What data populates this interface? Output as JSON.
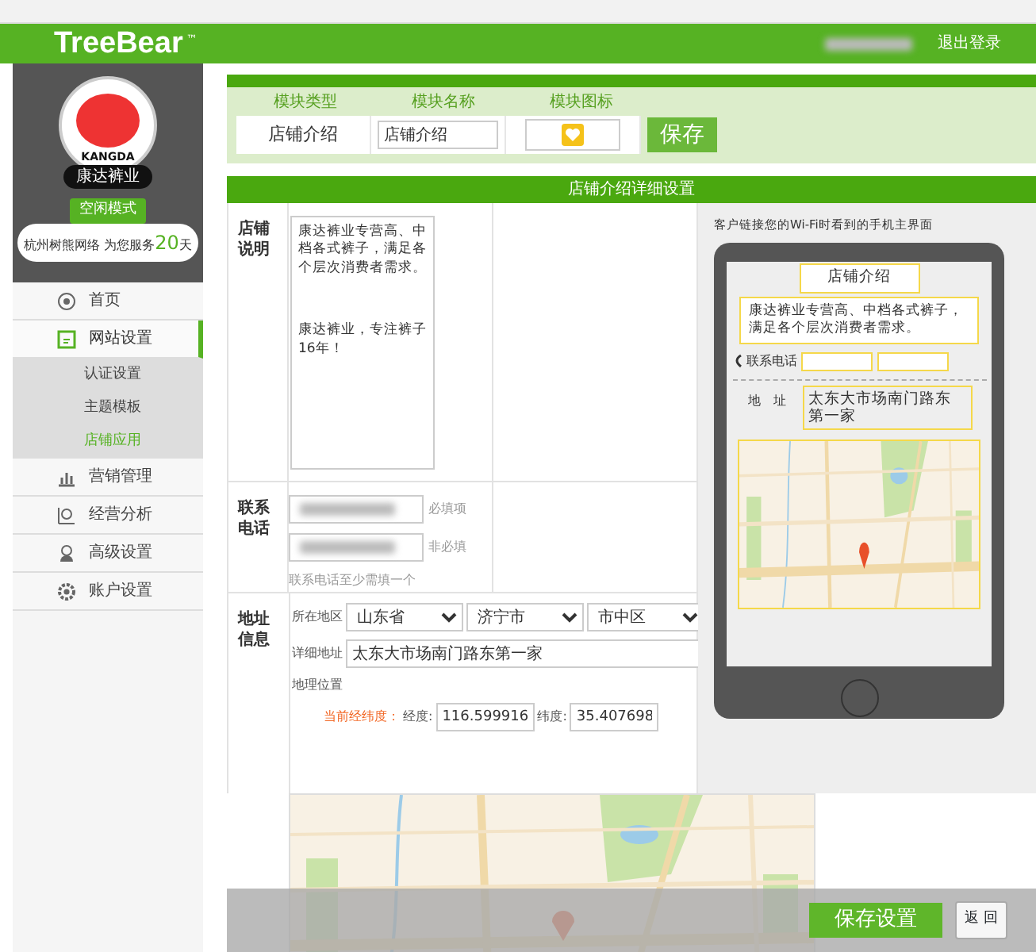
{
  "header": {
    "logo": "TreeBear",
    "trademark": "™",
    "logout": "退出登录"
  },
  "sidebar": {
    "logo_text": "KANGDA",
    "shop_name": "康达裤业",
    "mode_badge": "空闲模式",
    "service_prefix": "杭州树熊网络 为您服务",
    "service_days": "20",
    "service_suffix": "天",
    "menu": [
      {
        "label": "首页",
        "selected": false
      },
      {
        "label": "网站设置",
        "selected": true,
        "children": [
          {
            "label": "认证设置",
            "selected": false
          },
          {
            "label": "主题模板",
            "selected": false
          },
          {
            "label": "店铺应用",
            "selected": true
          }
        ]
      },
      {
        "label": "营销管理",
        "selected": false
      },
      {
        "label": "经营分析",
        "selected": false
      },
      {
        "label": "高级设置",
        "selected": false
      },
      {
        "label": "账户设置",
        "selected": false
      }
    ]
  },
  "module": {
    "columns": [
      "模块类型",
      "模块名称",
      "模块图标"
    ],
    "type": "店铺介绍",
    "name_value": "店铺介绍",
    "save": "保存"
  },
  "detail_title": "店铺介绍详细设置",
  "form": {
    "description_label": "店铺说明",
    "description": [
      "康达裤业专营高、中档各式裤子，满足各个层次消费者需求。",
      "康达裤业，专注裤子16年！"
    ],
    "contact_label": "联系电话",
    "phones": [
      {
        "hint": "必填项"
      },
      {
        "hint": "非必填"
      }
    ],
    "contact_note": "联系电话至少需填一个",
    "address_label": "地址信息",
    "region_label": "所在地区",
    "province": "山东省",
    "city": "济宁市",
    "district": "市中区",
    "detail_label": "详细地址",
    "detail_value": "太东大市场南门路东第一家",
    "geo_label": "地理位置",
    "coords_label": "当前经纬度：",
    "lng_label": "经度:",
    "lng": "116.599916",
    "lat_label": "纬度:",
    "lat": "35.407698"
  },
  "preview": {
    "caption": "客户链接您的Wi-Fi时看到的手机主界面",
    "title": "店铺介绍",
    "description": "康达裤业专营高、中档各式裤子，满足各个层次消费者需求。",
    "phone_label": "联系电话",
    "address_label": "地　址",
    "address": "太东大市场南门路东第一家"
  },
  "footer": {
    "save": "保存设置",
    "back": "返 回"
  }
}
